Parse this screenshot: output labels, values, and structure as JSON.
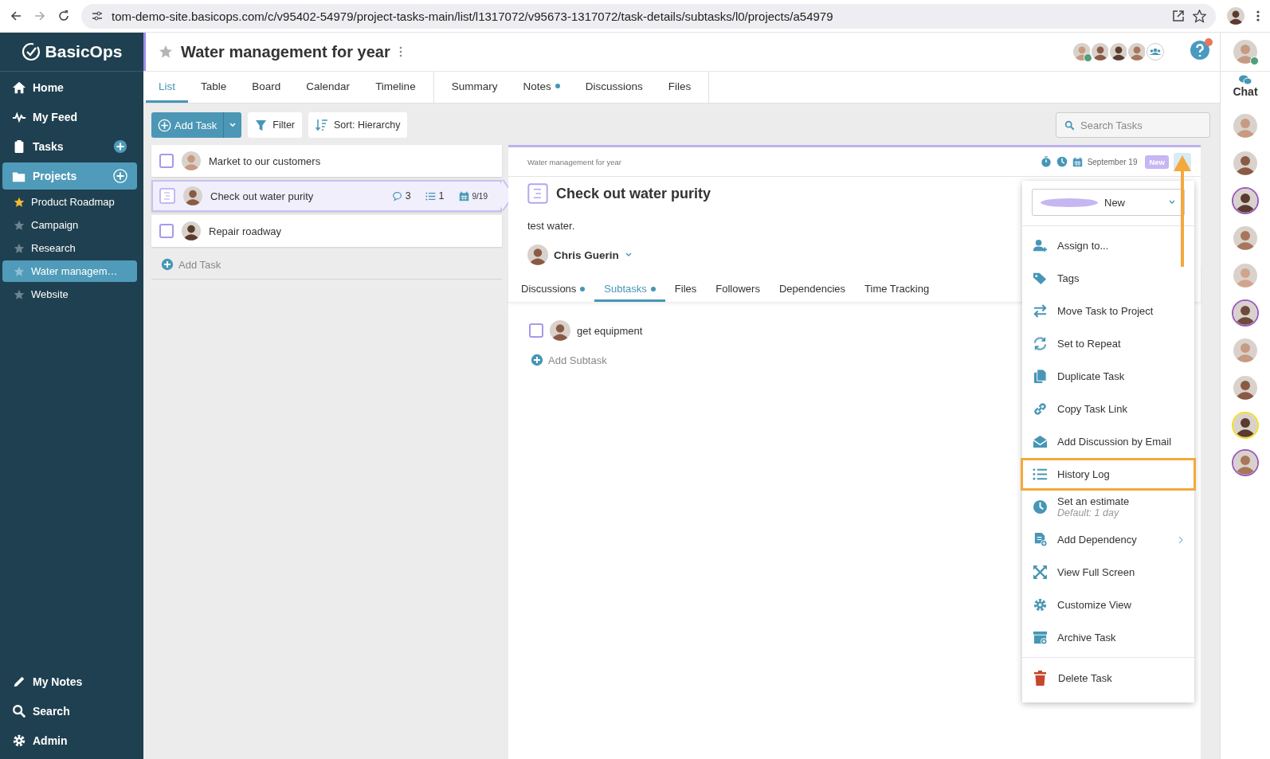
{
  "browser": {
    "url": "tom-demo-site.basicops.com/c/v95402-54979/project-tasks-main/list/l1317072/v95673-1317072/task-details/subtasks/l0/projects/a54979"
  },
  "sidebar": {
    "logo": "BasicOps",
    "nav": [
      {
        "label": "Home",
        "selected": false,
        "add": false
      },
      {
        "label": "My Feed",
        "selected": false,
        "add": false
      },
      {
        "label": "Tasks",
        "selected": false,
        "add": true
      },
      {
        "label": "Projects",
        "selected": true,
        "add": true
      }
    ],
    "projects": [
      {
        "label": "Product Roadmap",
        "starred": true,
        "selected": false
      },
      {
        "label": "Campaign",
        "starred": false,
        "selected": false
      },
      {
        "label": "Research",
        "starred": false,
        "selected": false
      },
      {
        "label": "Water managem…",
        "starred": false,
        "selected": true
      },
      {
        "label": "Website",
        "starred": false,
        "selected": false
      }
    ],
    "bottom": [
      {
        "label": "My Notes"
      },
      {
        "label": "Search"
      },
      {
        "label": "Admin"
      }
    ]
  },
  "header": {
    "title": "Water management for year",
    "starred": false,
    "members": [
      {
        "online": true
      },
      {
        "online": false
      },
      {
        "online": false
      },
      {
        "online": false
      }
    ],
    "help_badge": true,
    "view_tabs": [
      {
        "label": "List",
        "selected": true,
        "dot": false
      },
      {
        "label": "Table",
        "selected": false,
        "dot": false
      },
      {
        "label": "Board",
        "selected": false,
        "dot": false
      },
      {
        "label": "Calendar",
        "selected": false,
        "dot": false
      },
      {
        "label": "Timeline",
        "selected": false,
        "dot": false
      }
    ],
    "page_tabs": [
      {
        "label": "Summary",
        "selected": false,
        "dot": false
      },
      {
        "label": "Notes",
        "selected": false,
        "dot": true
      },
      {
        "label": "Discussions",
        "selected": false,
        "dot": false
      },
      {
        "label": "Files",
        "selected": false,
        "dot": false
      }
    ]
  },
  "toolbar": {
    "add_task": "Add Task",
    "filter": "Filter",
    "sort": "Sort: Hierarchy",
    "search_placeholder": "Search Tasks"
  },
  "tasks": {
    "items": [
      {
        "title": "Market to our customers",
        "checked": false,
        "selected": false
      },
      {
        "title": "Check out water purity",
        "checked": false,
        "selected": true,
        "comments": "3",
        "subtasks": "1",
        "due": "9/19"
      },
      {
        "title": "Repair roadway",
        "checked": false,
        "selected": false
      }
    ],
    "add_label": "Add Task"
  },
  "detail": {
    "project": "Water management for year",
    "date": "September 19",
    "status": "New",
    "title": "Check out water purity",
    "description": "test water.",
    "assignee": "Chris Guerin",
    "tabs": [
      {
        "label": "Discussions",
        "selected": false,
        "dot": true
      },
      {
        "label": "Subtasks",
        "selected": true,
        "dot": true
      },
      {
        "label": "Files",
        "selected": false,
        "dot": false
      },
      {
        "label": "Followers",
        "selected": false,
        "dot": false
      },
      {
        "label": "Dependencies",
        "selected": false,
        "dot": false
      },
      {
        "label": "Time Tracking",
        "selected": false,
        "dot": false
      }
    ],
    "subtasks": [
      {
        "title": "get equipment",
        "checked": false
      }
    ],
    "add_subtask": "Add Subtask"
  },
  "menu": {
    "status": {
      "label": "New",
      "color": "#c6b6f2"
    },
    "items": [
      {
        "label": "Assign to...",
        "highlighted": false
      },
      {
        "label": "Tags",
        "highlighted": false
      },
      {
        "label": "Move Task to Project",
        "highlighted": false
      },
      {
        "label": "Set to Repeat",
        "highlighted": false
      },
      {
        "label": "Duplicate Task",
        "highlighted": false
      },
      {
        "label": "Copy Task Link",
        "highlighted": false
      },
      {
        "label": "Add Discussion by Email",
        "highlighted": false
      },
      {
        "label": "History Log",
        "highlighted": true
      },
      {
        "label": "Set an estimate",
        "note": "Default: 1 day",
        "highlighted": false
      },
      {
        "label": "Add Dependency",
        "submenu": true,
        "highlighted": false
      },
      {
        "label": "View Full Screen",
        "highlighted": false
      },
      {
        "label": "Customize View",
        "highlighted": false
      },
      {
        "label": "Archive Task",
        "highlighted": false
      }
    ],
    "delete": "Delete Task",
    "arrow": true
  },
  "chat": {
    "label": "Chat",
    "user_online": true,
    "members": [
      {
        "ring": false
      },
      {
        "ring": false
      },
      {
        "ring": true,
        "color": "#9b5cc0"
      },
      {
        "ring": false
      },
      {
        "ring": false
      },
      {
        "ring": true,
        "color": "#9b5cc0"
      },
      {
        "ring": false
      },
      {
        "ring": false
      },
      {
        "ring": true,
        "color": "#f2dc2a"
      },
      {
        "ring": true,
        "color": "#9b5cc0"
      }
    ]
  }
}
